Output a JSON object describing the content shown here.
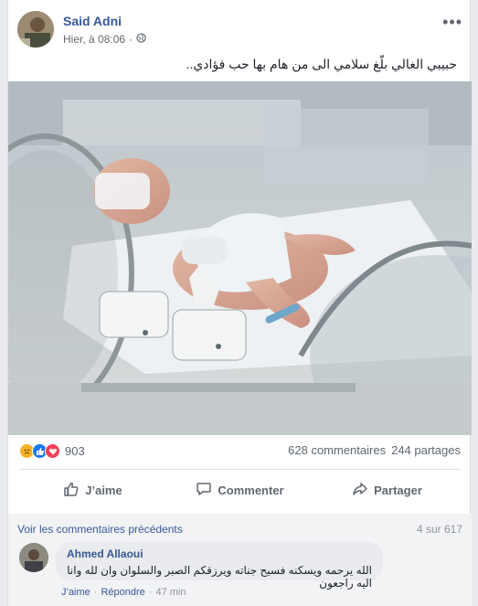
{
  "post": {
    "author": "Said Adni",
    "time": "Hier, à 08:06",
    "privacy_icon": "globe-icon",
    "text": "حبيبي الغالي بلّغ سلامي الى من هام بها حب فؤادي..",
    "more_icon": "ellipsis-icon"
  },
  "stats": {
    "reactions": [
      "sad",
      "like",
      "love"
    ],
    "reaction_count": "903",
    "comments": "628 commentaires",
    "shares": "244 partages"
  },
  "actions": {
    "like": "J’aime",
    "comment": "Commenter",
    "share": "Partager"
  },
  "comments": {
    "view_previous": "Voir les commentaires précédents",
    "pagination": "4 sur 617",
    "items": [
      {
        "author": "Ahmed Allaoui",
        "text": "الله يرحمه ويسكنه فسيح جناته ويرزقكم الصبر والسلوان وان لله وانا اليه راجعون",
        "like": "J’aime",
        "reply": "Répondre",
        "time": "47 min"
      }
    ]
  },
  "colors": {
    "link": "#365899",
    "like_blue": "#1877f2",
    "love_red": "#f33e58",
    "sad_yellow": "#f7b125"
  }
}
